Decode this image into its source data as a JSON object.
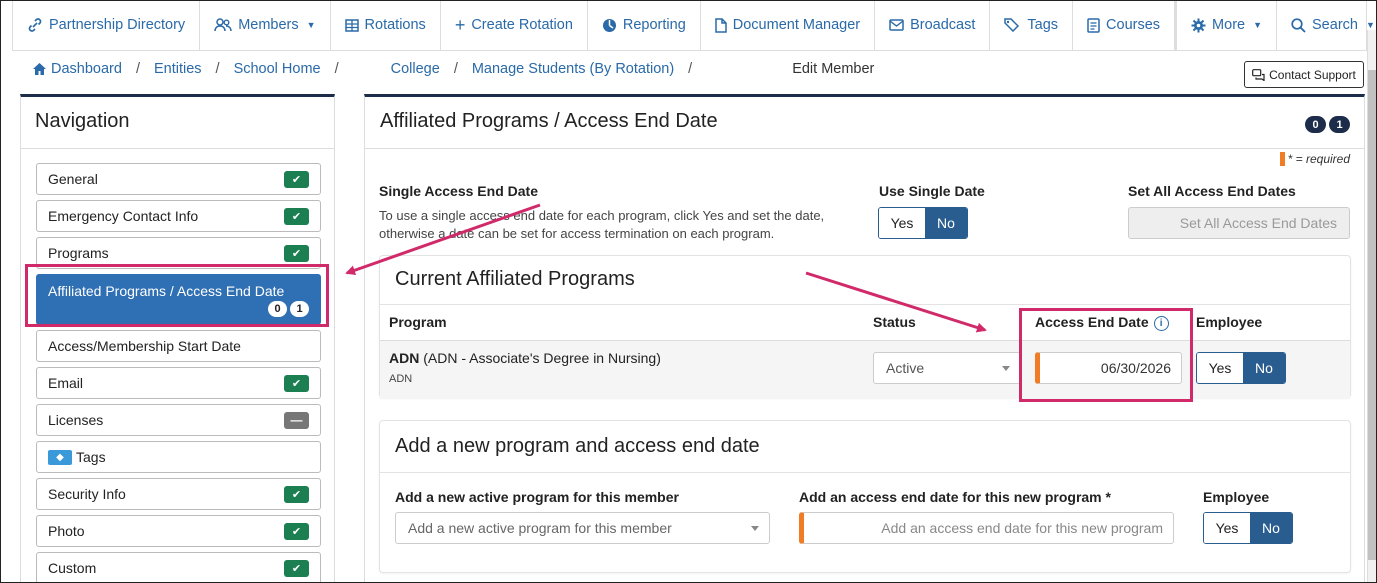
{
  "topnav": {
    "items": [
      {
        "icon": "link-icon",
        "label": "Partnership Directory"
      },
      {
        "icon": "users-icon",
        "label": "Members",
        "caret": true
      },
      {
        "icon": "table-icon",
        "label": "Rotations"
      },
      {
        "icon": "plus-icon",
        "label": "Create Rotation"
      },
      {
        "icon": "chart-icon",
        "label": "Reporting"
      },
      {
        "icon": "file-icon",
        "label": "Document Manager"
      },
      {
        "icon": "envelope-icon",
        "label": "Broadcast"
      },
      {
        "icon": "tag-icon",
        "label": "Tags"
      },
      {
        "icon": "book-icon",
        "label": "Courses"
      }
    ],
    "more_label": "More",
    "search_label": "Search"
  },
  "breadcrumb": {
    "dashboard": "Dashboard",
    "entities": "Entities",
    "school_home": "School Home",
    "college": "College",
    "manage_students": "Manage Students (By Rotation)",
    "current": "Edit Member",
    "separator": "/"
  },
  "contact_support": "Contact Support",
  "navigation": {
    "title": "Navigation",
    "items": [
      {
        "label": "General",
        "status": "check"
      },
      {
        "label": "Emergency Contact Info",
        "status": "check"
      },
      {
        "label": "Programs",
        "status": "check"
      },
      {
        "label": "Affiliated Programs / Access End Date",
        "status": "active",
        "badges": [
          "0",
          "1"
        ]
      },
      {
        "label": "Access/Membership Start Date",
        "status": "none"
      },
      {
        "label": "Email",
        "status": "check"
      },
      {
        "label": "Licenses",
        "status": "dash"
      },
      {
        "label": "Tags",
        "status": "tag"
      },
      {
        "label": "Security Info",
        "status": "check"
      },
      {
        "label": "Photo",
        "status": "check"
      },
      {
        "label": "Custom",
        "status": "check"
      }
    ]
  },
  "main": {
    "title": "Affiliated Programs / Access End Date",
    "badges": [
      "0",
      "1"
    ],
    "required_note": "* = required",
    "single_date": {
      "label": "Single Access End Date",
      "help": "To use a single access end date for each program, click Yes and set the date, otherwise a date can be set for access termination on each program."
    },
    "use_single": {
      "label": "Use Single Date",
      "yes": "Yes",
      "no": "No"
    },
    "set_all": {
      "label": "Set All Access End Dates",
      "button": "Set All Access End Dates"
    },
    "current": {
      "title": "Current Affiliated Programs",
      "headers": {
        "program": "Program",
        "status": "Status",
        "end_date": "Access End Date",
        "employee": "Employee"
      },
      "row": {
        "code": "ADN",
        "name": "(ADN - Associate's Degree in Nursing)",
        "sub": "ADN",
        "status": "Active",
        "end_date": "06/30/2026",
        "yes": "Yes",
        "no": "No"
      }
    },
    "add_new": {
      "title": "Add a new program and access end date",
      "program_label": "Add a new active program for this member",
      "program_placeholder": "Add a new active program for this member",
      "date_label": "Add an access end date for this new program *",
      "date_placeholder": "Add an access end date for this new program",
      "employee_label": "Employee",
      "yes": "Yes",
      "no": "No"
    }
  },
  "colors": {
    "accent": "#2f6fb3",
    "dark_toggle": "#2a5d8f",
    "check_green": "#1b7f52",
    "annotation": "#d02a6a",
    "required_orange": "#f07c26"
  }
}
